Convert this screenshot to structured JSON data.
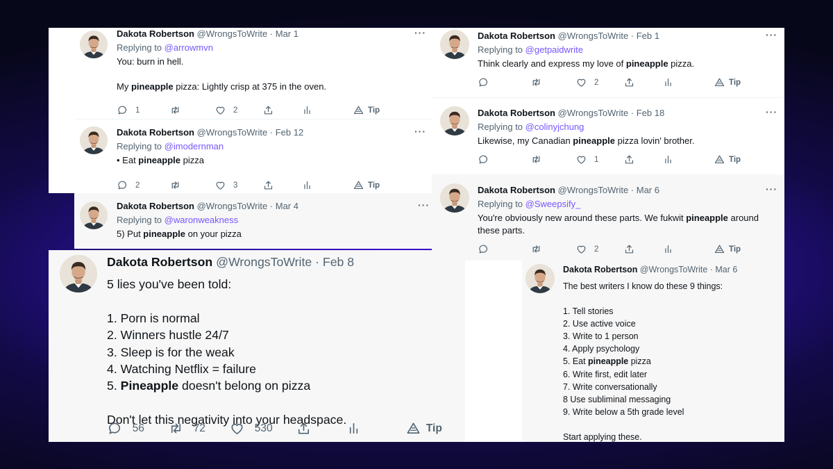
{
  "author": {
    "name": "Dakota Robertson",
    "handle": "@WrongsToWrite"
  },
  "labels": {
    "replying_to": "Replying to",
    "tip": "Tip",
    "more": "···"
  },
  "colors": {
    "background": "#2b12b4",
    "link": "#7856ff",
    "card": "#ffffff",
    "card_alt": "#f7f7f7",
    "muted": "#536471"
  },
  "tweets": [
    {
      "date": "· Mar 1",
      "reply_to": "@arrowmvn",
      "lines": [
        [
          {
            "t": "You: burn in hell."
          }
        ],
        [
          {
            "t": ""
          }
        ],
        [
          {
            "t": "My "
          },
          {
            "t": "pineapple",
            "b": true
          },
          {
            "t": " pizza: Lightly crisp at 375 in the oven."
          }
        ]
      ],
      "replies": "1",
      "retweets": "",
      "likes": "2"
    },
    {
      "date": "· Feb 12",
      "reply_to": "@imodernman",
      "lines": [
        [
          {
            "t": "• Eat "
          },
          {
            "t": "pineapple",
            "b": true
          },
          {
            "t": " pizza"
          }
        ]
      ],
      "replies": "2",
      "retweets": "",
      "likes": "3"
    },
    {
      "date": "· Mar 4",
      "reply_to": "@waronweakness",
      "lines": [
        [
          {
            "t": "5) Put "
          },
          {
            "t": "pineapple",
            "b": true
          },
          {
            "t": " on your pizza"
          }
        ]
      ],
      "replies": "",
      "retweets": "",
      "likes": ""
    },
    {
      "date": "· Feb 8",
      "reply_to": "",
      "lines": [
        [
          {
            "t": "5 lies you've been told:"
          }
        ],
        [
          {
            "t": ""
          }
        ],
        [
          {
            "t": "1. Porn is normal"
          }
        ],
        [
          {
            "t": "2. Winners hustle 24/7"
          }
        ],
        [
          {
            "t": "3. Sleep is for the weak"
          }
        ],
        [
          {
            "t": "4. Watching Netflix = failure"
          }
        ],
        [
          {
            "t": "5. "
          },
          {
            "t": "Pineapple",
            "b": true
          },
          {
            "t": " doesn't belong on pizza"
          }
        ],
        [
          {
            "t": ""
          }
        ],
        [
          {
            "t": "Don't let this negativity into your headspace."
          }
        ]
      ],
      "replies": "56",
      "retweets": "72",
      "likes": "530"
    },
    {
      "date": "· Feb 1",
      "reply_to": "@getpaidwrite",
      "lines": [
        [
          {
            "t": "Think clearly and express my love of "
          },
          {
            "t": "pineapple",
            "b": true
          },
          {
            "t": " pizza."
          }
        ]
      ],
      "replies": "",
      "retweets": "",
      "likes": "2"
    },
    {
      "date": "· Feb 18",
      "reply_to": "@colinyjchung",
      "lines": [
        [
          {
            "t": "Likewise, my Canadian "
          },
          {
            "t": "pineapple",
            "b": true
          },
          {
            "t": " pizza lovin' brother."
          }
        ]
      ],
      "replies": "",
      "retweets": "",
      "likes": "1"
    },
    {
      "date": "· Mar 6",
      "reply_to": "@Sweepsify_",
      "lines": [
        [
          {
            "t": "You're obviously new around these parts. We fukwit "
          },
          {
            "t": "pineapple",
            "b": true
          },
          {
            "t": " around"
          }
        ],
        [
          {
            "t": "these parts."
          }
        ]
      ],
      "replies": "",
      "retweets": "",
      "likes": "2"
    },
    {
      "date": "· Mar 6",
      "reply_to": "",
      "lines": [
        [
          {
            "t": "The best writers I know do these 9 things:"
          }
        ],
        [
          {
            "t": ""
          }
        ],
        [
          {
            "t": "1. Tell stories"
          }
        ],
        [
          {
            "t": "2. Use active voice"
          }
        ],
        [
          {
            "t": "3. Write to 1 person"
          }
        ],
        [
          {
            "t": "4. Apply psychology"
          }
        ],
        [
          {
            "t": "5. Eat "
          },
          {
            "t": "pineapple",
            "b": true
          },
          {
            "t": " pizza"
          }
        ],
        [
          {
            "t": "6. Write first, edit later"
          }
        ],
        [
          {
            "t": "7. Write conversationally"
          }
        ],
        [
          {
            "t": "8 Use subliminal messaging"
          }
        ],
        [
          {
            "t": "9. Write below a 5th grade level"
          }
        ],
        [
          {
            "t": ""
          }
        ],
        [
          {
            "t": "Start applying these."
          }
        ]
      ],
      "replies": "",
      "retweets": "",
      "likes": ""
    }
  ]
}
